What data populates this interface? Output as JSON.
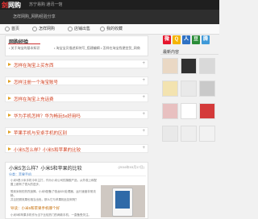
{
  "site": {
    "logo_main": "剑",
    "logo_rest": "网购",
    "topnav": "苏宁易购 通讯一馆",
    "tagline": "怎样网购_网购经验分享"
  },
  "nav": [
    {
      "label": "首页"
    },
    {
      "label": "怎样网购"
    },
    {
      "label": "店铺出售"
    },
    {
      "label": "我的收藏"
    }
  ],
  "section": {
    "title": "网购经验",
    "notice1": "• 关于淘宝的基本知识",
    "notice2": "• 淘宝宝贝描述如何写_搭建编辑",
    "notice3": "• 怎样在淘宝找便宜货_网商"
  },
  "questions": [
    {
      "text": "怎样在淘宝上买东西"
    },
    {
      "text": "怎样注册一个淘宝账号"
    },
    {
      "text": "怎样在淘宝上充话费"
    },
    {
      "text": "华为手机怎样？华为畅玩5x好用吗"
    },
    {
      "text": "苹果手机与安卓手机的区别"
    },
    {
      "text": "小米5怎么样？小米5和苹果的比较"
    }
  ],
  "article": {
    "title": "小米5怎么样？小米5和苹果的比较",
    "date": "(2016年03月17日)",
    "meta": "分类：苹果手机",
    "para1": "小米5是小米手机今年主打，作为小米公司的旗舰产品，从外观上和配置上都有了很大的进步，",
    "para2": "受到米粉的热烈追捧。小米5配备了骁龙820处理器，运行速度非常流畅，",
    "para3": "并且拍照效果也相当出色，那么它与苹果相比如何呢？",
    "highlight": "导读：小米5和苹果手机哪个好",
    "tail": "小米5和苹果手机作为当下比较热门的两款手机，一直备受关注。"
  },
  "sidebar": {
    "title": "最新内容",
    "icons": [
      {
        "name": "weibo",
        "char": "微",
        "color": "#e6162d"
      },
      {
        "name": "qzone",
        "char": "Q",
        "color": "#f5b400"
      },
      {
        "name": "renren",
        "char": "人",
        "color": "#2f72c4"
      },
      {
        "name": "douban",
        "char": "豆",
        "color": "#2b8d38"
      },
      {
        "name": "tencent",
        "char": "腾",
        "color": "#3f99d8"
      }
    ]
  }
}
